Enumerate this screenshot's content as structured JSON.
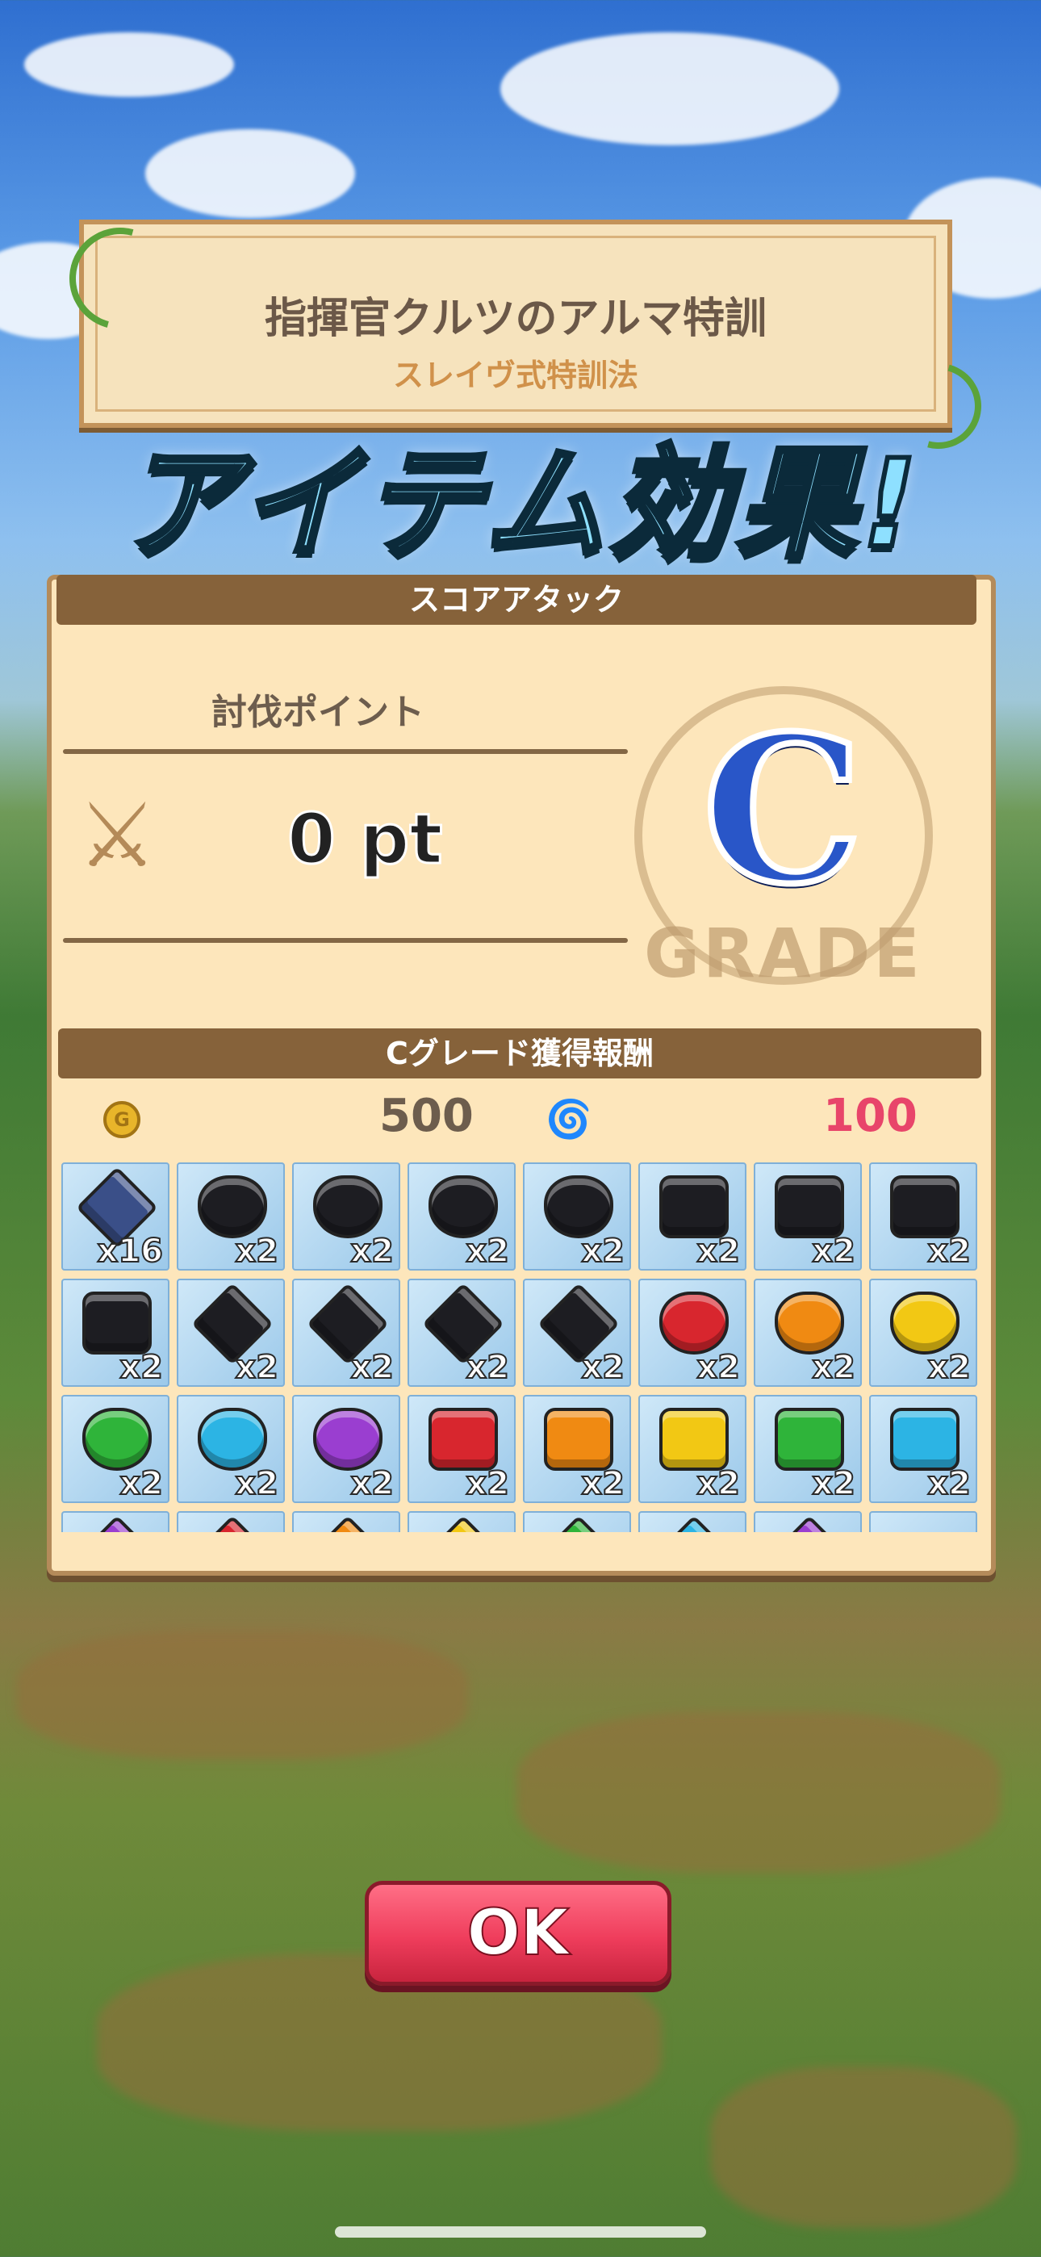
{
  "header": {
    "title": "指揮官クルツのアルマ特訓",
    "subtitle": "スレイヴ式特訓法"
  },
  "banner": {
    "text": "アイテム効果!"
  },
  "score_attack": {
    "header": "スコアアタック",
    "points_label": "討伐ポイント",
    "points_value": "0 pt",
    "grade_letter": "C",
    "grade_word": "GRADE"
  },
  "rewards": {
    "header": "Cグレード獲得報酬",
    "coin_amount": "500",
    "spiral_amount": "100",
    "coin_color": "#6d5d4d",
    "spiral_color": "#e8456a",
    "items": [
      {
        "icon": "star-crest-gem-icon",
        "color": "#3a4f88",
        "shape": "star",
        "qty": "x16"
      },
      {
        "icon": "red-sword-black-gem-icon",
        "color": "#1d1d22",
        "shape": "round",
        "qty": "x2"
      },
      {
        "icon": "green-sword-black-gem-icon",
        "color": "#1d1d22",
        "shape": "round",
        "qty": "x2"
      },
      {
        "icon": "pink-crystal-black-gem-icon",
        "color": "#1d1d22",
        "shape": "round",
        "qty": "x2"
      },
      {
        "icon": "purple-sword-black-gem-icon",
        "color": "#1d1d22",
        "shape": "round",
        "qty": "x2"
      },
      {
        "icon": "red-sword-black-hex-gem-icon",
        "color": "#1d1d22",
        "shape": "hex",
        "qty": "x2"
      },
      {
        "icon": "green-sword-black-hex-gem-icon",
        "color": "#1d1d22",
        "shape": "hex",
        "qty": "x2"
      },
      {
        "icon": "pink-crystal-black-hex-gem-icon",
        "color": "#1d1d22",
        "shape": "hex",
        "qty": "x2"
      },
      {
        "icon": "purple-sword-black-hex-gem-icon",
        "color": "#1d1d22",
        "shape": "hex",
        "qty": "x2"
      },
      {
        "icon": "red-sword-black-star-gem-icon",
        "color": "#1d1d22",
        "shape": "star",
        "qty": "x2"
      },
      {
        "icon": "green-sword-black-star-gem-icon",
        "color": "#1d1d22",
        "shape": "star",
        "qty": "x2"
      },
      {
        "icon": "pink-crystal-black-star-gem-icon",
        "color": "#1d1d22",
        "shape": "star",
        "qty": "x2"
      },
      {
        "icon": "purple-sword-black-star-gem-icon",
        "color": "#1d1d22",
        "shape": "star",
        "qty": "x2"
      },
      {
        "icon": "red-round-gem-icon",
        "color": "#d8262e",
        "shape": "round",
        "qty": "x2"
      },
      {
        "icon": "orange-round-gem-icon",
        "color": "#f08a12",
        "shape": "round",
        "qty": "x2"
      },
      {
        "icon": "yellow-round-gem-icon",
        "color": "#f2c814",
        "shape": "round",
        "qty": "x2"
      },
      {
        "icon": "green-round-gem-icon",
        "color": "#2fb43a",
        "shape": "round",
        "qty": "x2"
      },
      {
        "icon": "cyan-round-gem-icon",
        "color": "#2cb4e4",
        "shape": "round",
        "qty": "x2"
      },
      {
        "icon": "purple-round-gem-icon",
        "color": "#9a3ed0",
        "shape": "round",
        "qty": "x2"
      },
      {
        "icon": "red-hex-gem-icon",
        "color": "#d8262e",
        "shape": "hex",
        "qty": "x2"
      },
      {
        "icon": "orange-hex-gem-icon",
        "color": "#f08a12",
        "shape": "hex",
        "qty": "x2"
      },
      {
        "icon": "yellow-hex-gem-icon",
        "color": "#f2c814",
        "shape": "hex",
        "qty": "x2"
      },
      {
        "icon": "green-hex-gem-icon",
        "color": "#2fb43a",
        "shape": "hex",
        "qty": "x2"
      },
      {
        "icon": "cyan-hex-gem-icon",
        "color": "#2cb4e4",
        "shape": "hex",
        "qty": "x2"
      },
      {
        "icon": "purple-star-gem-icon",
        "color": "#9a3ed0",
        "shape": "star",
        "qty": ""
      },
      {
        "icon": "red-star-gem-icon",
        "color": "#d8262e",
        "shape": "star",
        "qty": ""
      },
      {
        "icon": "orange-star-gem-icon",
        "color": "#f08a12",
        "shape": "star",
        "qty": ""
      },
      {
        "icon": "yellow-star-gem-icon",
        "color": "#f2c814",
        "shape": "star",
        "qty": ""
      },
      {
        "icon": "green-star-gem-icon",
        "color": "#2fb43a",
        "shape": "star",
        "qty": ""
      },
      {
        "icon": "cyan-star-gem-icon",
        "color": "#2cb4e4",
        "shape": "star",
        "qty": ""
      },
      {
        "icon": "purple-star-gem-icon",
        "color": "#9a3ed0",
        "shape": "star",
        "qty": ""
      },
      {
        "icon": "empty-slot-icon",
        "color": "#9cc9ea",
        "shape": "none",
        "qty": ""
      }
    ]
  },
  "ok_button": {
    "label": "OK"
  }
}
